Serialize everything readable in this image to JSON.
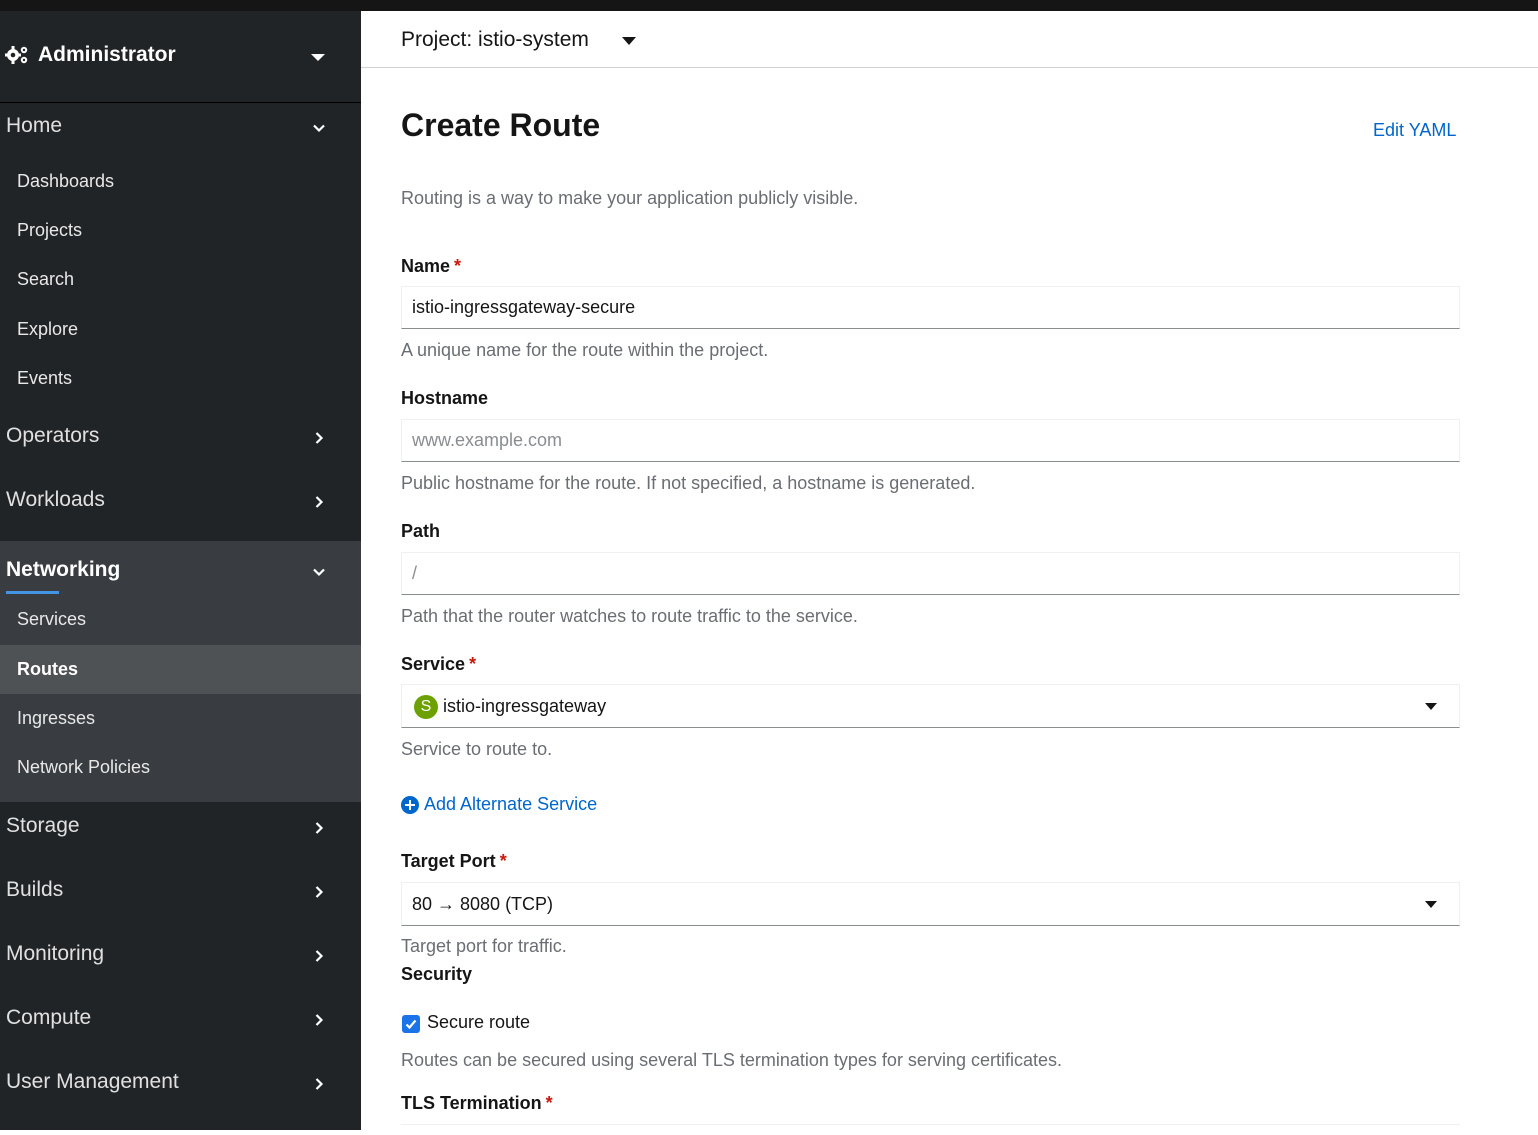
{
  "sidebar": {
    "perspective": "Administrator",
    "sections": {
      "home": {
        "label": "Home",
        "items": [
          "Dashboards",
          "Projects",
          "Search",
          "Explore",
          "Events"
        ]
      },
      "operators": "Operators",
      "workloads": "Workloads",
      "networking": {
        "label": "Networking",
        "items": [
          "Services",
          "Routes",
          "Ingresses",
          "Network Policies"
        ],
        "active_item": "Routes"
      },
      "storage": "Storage",
      "builds": "Builds",
      "monitoring": "Monitoring",
      "compute": "Compute",
      "user_management": "User Management"
    }
  },
  "header": {
    "project_label": "Project: istio-system"
  },
  "page": {
    "title": "Create Route",
    "edit_yaml": "Edit YAML",
    "description": "Routing is a way to make your application publicly visible."
  },
  "form": {
    "name": {
      "label": "Name",
      "required_mark": "*",
      "value": "istio-ingressgateway-secure",
      "help": "A unique name for the route within the project."
    },
    "hostname": {
      "label": "Hostname",
      "placeholder": "www.example.com",
      "help": "Public hostname for the route. If not specified, a hostname is generated."
    },
    "path": {
      "label": "Path",
      "placeholder": "/",
      "help": "Path that the router watches to route traffic to the service."
    },
    "service": {
      "label": "Service",
      "required_mark": "*",
      "badge": "S",
      "value": "istio-ingressgateway",
      "help": "Service to route to."
    },
    "add_alternate_service": "Add Alternate Service",
    "target_port": {
      "label": "Target Port",
      "required_mark": "*",
      "value": "80 → 8080 (TCP)",
      "help": "Target port for traffic."
    },
    "security": {
      "label": "Security",
      "secure_route_label": "Secure route",
      "secure_route_checked": true,
      "help": "Routes can be secured using several TLS termination types for serving certificates."
    },
    "tls_termination": {
      "label": "TLS Termination",
      "required_mark": "*"
    }
  },
  "colors": {
    "sidebar_bg": "#212427",
    "nav_group_bg": "#393d41",
    "active_item_bg": "#4f5255",
    "active_indicator": "#4394e5",
    "link": "#0066cc",
    "required": "#c9190b",
    "service_badge": "#6ca100",
    "checkbox": "#1a73e8"
  },
  "icons": {
    "perspective": "gears-icon",
    "add": "plus-circle-icon",
    "expanded": "chevron-down-icon",
    "collapsed": "chevron-right-icon",
    "dropdown": "caret-down-icon"
  }
}
